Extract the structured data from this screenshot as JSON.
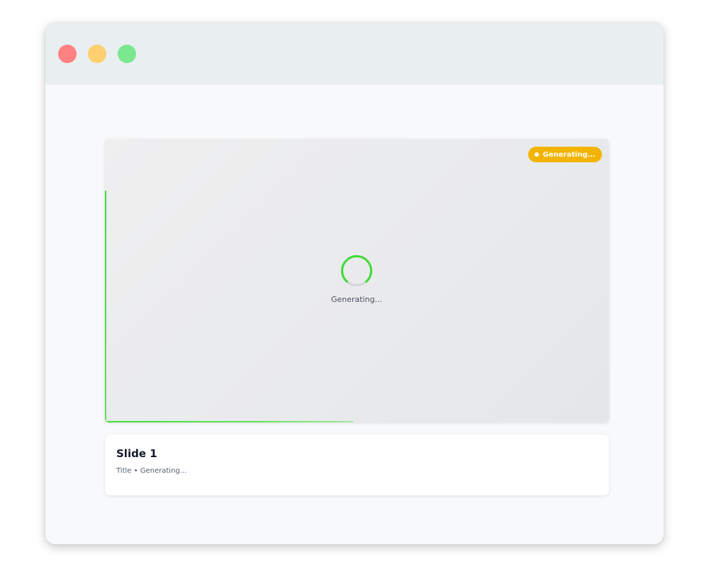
{
  "window": {
    "controls": {
      "close_color": "#ff8181",
      "minimize_color": "#ffcf70",
      "maximize_color": "#79e88e"
    }
  },
  "slide_preview": {
    "status_badge": "Generating...",
    "status_color": "#f2b400",
    "accent_color": "#3edc36",
    "loading_text": "Generating..."
  },
  "slide_info": {
    "title": "Slide 1",
    "layout": "Title",
    "separator": "•",
    "status": "Generating..."
  }
}
